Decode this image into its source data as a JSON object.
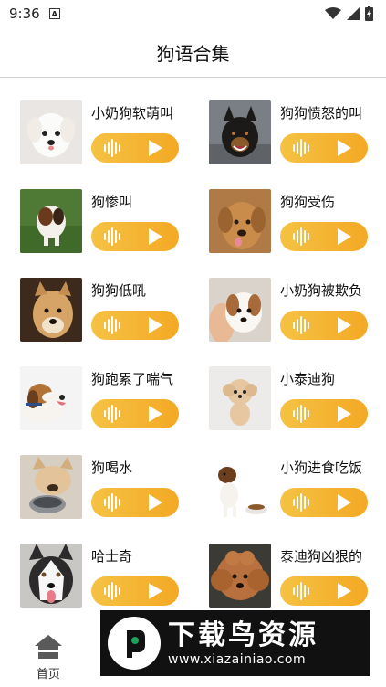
{
  "status": {
    "time": "9:36",
    "notif_icon": "a-icon"
  },
  "header": {
    "title": "狗语合集"
  },
  "items": [
    {
      "name": "小奶狗软萌叫",
      "photo": "white-puppy"
    },
    {
      "name": "狗狗愤怒的叫",
      "photo": "black-dog"
    },
    {
      "name": "狗惨叫",
      "photo": "terrier-on-grass"
    },
    {
      "name": "狗狗受伤",
      "photo": "golden-dog"
    },
    {
      "name": "狗狗低吼",
      "photo": "shiba-dog"
    },
    {
      "name": "小奶狗被欺负",
      "photo": "held-puppy"
    },
    {
      "name": "狗跑累了喘气",
      "photo": "beagle"
    },
    {
      "name": "小泰迪狗",
      "photo": "teddy-puppy"
    },
    {
      "name": "狗喝水",
      "photo": "bulldog-bowl"
    },
    {
      "name": "小狗进食吃饭",
      "photo": "jack-russell"
    },
    {
      "name": "哈士奇",
      "photo": "husky"
    },
    {
      "name": "泰迪狗凶狠的",
      "photo": "brown-poodle"
    }
  ],
  "tabbar": {
    "tabs": [
      {
        "label": "首页",
        "icon": "home-icon"
      }
    ]
  },
  "watermark": {
    "title": "下载鸟资源",
    "url": "www.xiazainiao.com"
  },
  "colors": {
    "button_start": "#f5c243",
    "button_end": "#f4a924"
  }
}
